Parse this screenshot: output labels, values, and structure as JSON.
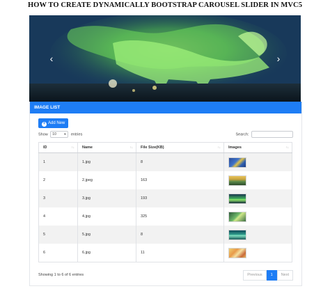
{
  "page": {
    "title": "HOW TO CREATE DYNAMICALLY BOOTSTRAP CAROUSEL SLIDER IN MVC5"
  },
  "carousel": {
    "prev_icon": "chevron-left-icon",
    "next_icon": "chevron-right-icon",
    "prev_glyph": "‹",
    "next_glyph": "›"
  },
  "panel": {
    "heading": "IMAGE LIST"
  },
  "toolbar": {
    "add_label": "Add New",
    "add_icon": "plus-circle-icon",
    "plus_glyph": "+"
  },
  "length": {
    "show_label": "Show",
    "selected": "10",
    "entries_label": "entries"
  },
  "search": {
    "label": "Search:",
    "value": ""
  },
  "table": {
    "columns": [
      "ID",
      "Name",
      "File Size(KB)",
      "Images"
    ],
    "sort_glyph": "↑↓",
    "rows": [
      {
        "id": "1",
        "name": "1.jpg",
        "size": "8"
      },
      {
        "id": "2",
        "name": "2.jpeg",
        "size": "163"
      },
      {
        "id": "3",
        "name": "3.jpg",
        "size": "193"
      },
      {
        "id": "4",
        "name": "4.jpg",
        "size": "325"
      },
      {
        "id": "5",
        "name": "5.jpg",
        "size": "8"
      },
      {
        "id": "6",
        "name": "6.jpg",
        "size": "11"
      }
    ]
  },
  "footer": {
    "info": "Showing 1 to 6 of 6 entries",
    "previous": "Previous",
    "page": "1",
    "next": "Next"
  },
  "colors": {
    "accent": "#1e7df5",
    "row_stripe": "#f2f2f2"
  }
}
